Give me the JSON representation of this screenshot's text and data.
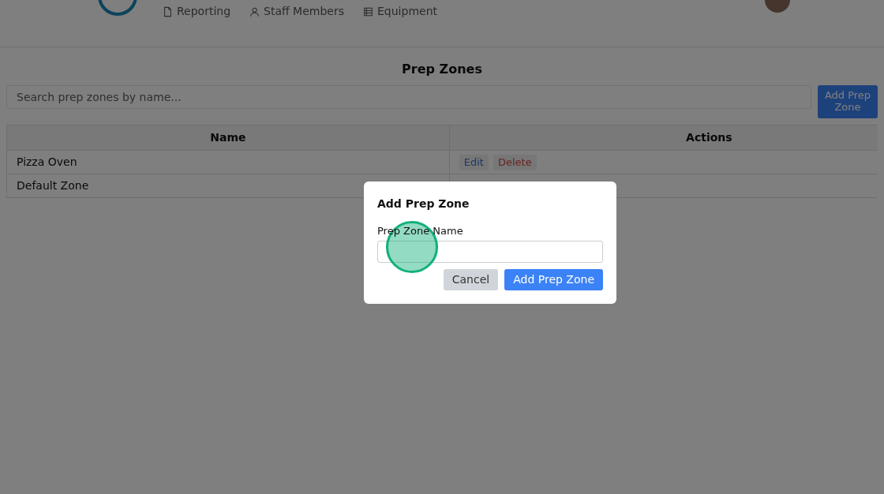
{
  "header": {
    "nav": [
      {
        "label": "Reporting"
      },
      {
        "label": "Staff Members"
      },
      {
        "label": "Equipment"
      }
    ]
  },
  "page": {
    "title": "Prep Zones",
    "search": {
      "placeholder": "Search prep zones by name..."
    },
    "add_button": "Add Prep Zone",
    "table": {
      "columns": [
        "Name",
        "Actions"
      ],
      "rows": [
        {
          "name": "Pizza Oven",
          "actions": [
            "Edit",
            "Delete"
          ]
        },
        {
          "name": "Default Zone"
        }
      ]
    }
  },
  "modal": {
    "title": "Add Prep Zone",
    "field_label": "Prep Zone Name",
    "buttons": [
      {
        "label": "Cancel",
        "kind": "secondary"
      },
      {
        "label": "Add Prep Zone",
        "kind": "primary"
      }
    ]
  },
  "click_indicator": true
}
